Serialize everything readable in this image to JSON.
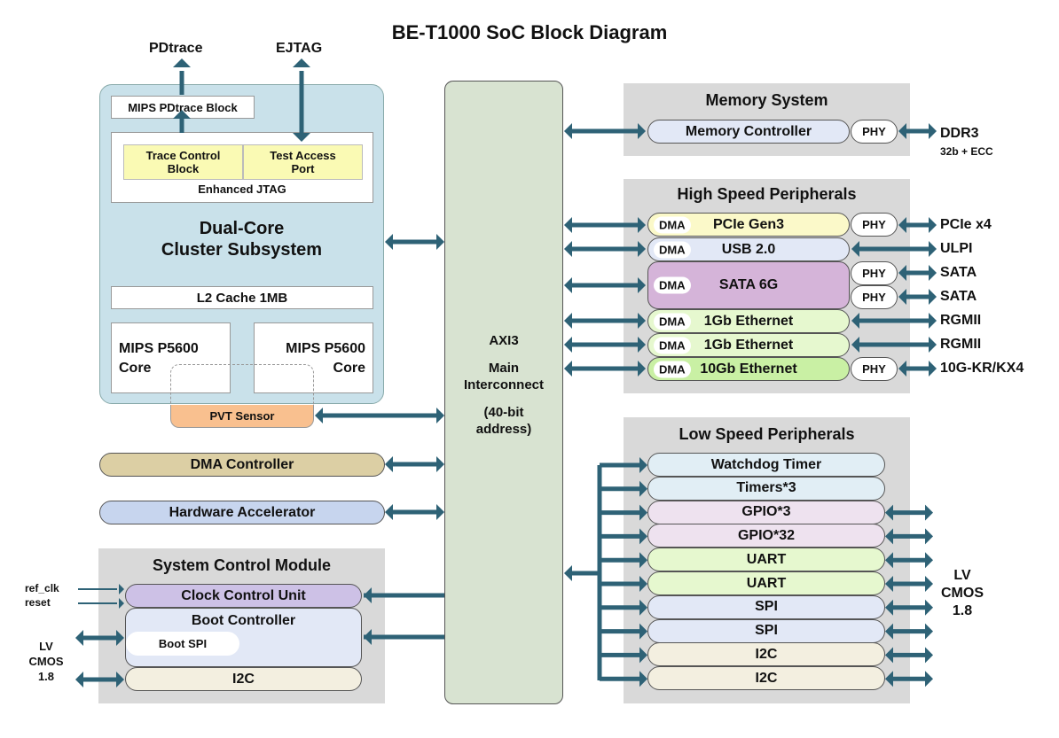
{
  "title": "BE-T1000 SoC Block Diagram",
  "colors": {
    "arrow": "#2e6276",
    "cluster_bg": "#c9e1ea",
    "interconnect_bg": "#d8e3d1",
    "group_bg": "#d9d9d9",
    "jtag_yellow": "#fafab4",
    "pvt_orange": "#f9c08f",
    "dma_ctrl": "#dccfa4",
    "hw_accel": "#c7d5ee",
    "clock_unit": "#cdc1e6",
    "boot_ctrl": "#e2e8f6",
    "i2c": "#f3efe0",
    "pcie": "#fbf9c9",
    "usb": "#e2e8f6",
    "sata": "#d5b4d9",
    "eth1g": "#e6f8cf",
    "eth10g": "#c9f0a4",
    "timer": "#e1eef5",
    "gpio": "#eee2ef",
    "uart": "#e6f8cf",
    "spi": "#e2e8f6"
  },
  "external": {
    "pdtrace": "PDtrace",
    "ejtag": "EJTAG"
  },
  "cluster": {
    "pdtrace_block": "MIPS PDtrace Block",
    "trace_control": "Trace Control Block",
    "test_access": "Test Access Port",
    "enhanced_jtag": "Enhanced JTAG",
    "title_line1": "Dual-Core",
    "title_line2": "Cluster Subsystem",
    "l2_cache": "L2 Cache 1MB",
    "core_left_line1": "MIPS P5600",
    "core_left_line2": "Core",
    "core_right_line1": "MIPS P5600",
    "core_right_line2": "Core",
    "pvt_sensor": "PVT Sensor"
  },
  "dma_controller": "DMA Controller",
  "hardware_accelerator": "Hardware Accelerator",
  "system_control": {
    "title": "System Control Module",
    "clock_unit": "Clock Control Unit",
    "boot_controller": "Boot Controller",
    "boot_spi": "Boot SPI",
    "i2c": "I2C",
    "ref_clk": "ref_clk",
    "reset": "reset",
    "lv_line1": "LV",
    "lv_line2": "CMOS",
    "lv_line3": "1.8"
  },
  "interconnect": {
    "line1": "AXI3",
    "line2": "Main",
    "line3": "Interconnect",
    "line4": "(40-bit",
    "line5": "address)"
  },
  "memory": {
    "title": "Memory System",
    "controller": "Memory Controller",
    "phy": "PHY",
    "ext": "DDR3",
    "ext_sub": "32b + ECC"
  },
  "high_speed": {
    "title": "High Speed Peripherals",
    "dma_label": "DMA",
    "phy_label": "PHY",
    "items": [
      {
        "name": "PCIe Gen3",
        "ext": "PCIe x4",
        "phy": true
      },
      {
        "name": "USB 2.0",
        "ext": "ULPI",
        "phy": false
      },
      {
        "name": "SATA 6G",
        "ext": "SATA",
        "ext2": "SATA",
        "phy": true
      },
      {
        "name": "1Gb Ethernet",
        "ext": "RGMII",
        "phy": false
      },
      {
        "name": "1Gb Ethernet",
        "ext": "RGMII",
        "phy": false
      },
      {
        "name": "10Gb Ethernet",
        "ext": "10G-KR/KX4",
        "phy": true
      }
    ]
  },
  "low_speed": {
    "title": "Low Speed Peripherals",
    "items": [
      "Watchdog Timer",
      "Timers*3",
      "GPIO*3",
      "GPIO*32",
      "UART",
      "UART",
      "SPI",
      "SPI",
      "I2C",
      "I2C"
    ],
    "lv_line1": "LV",
    "lv_line2": "CMOS",
    "lv_line3": "1.8"
  }
}
